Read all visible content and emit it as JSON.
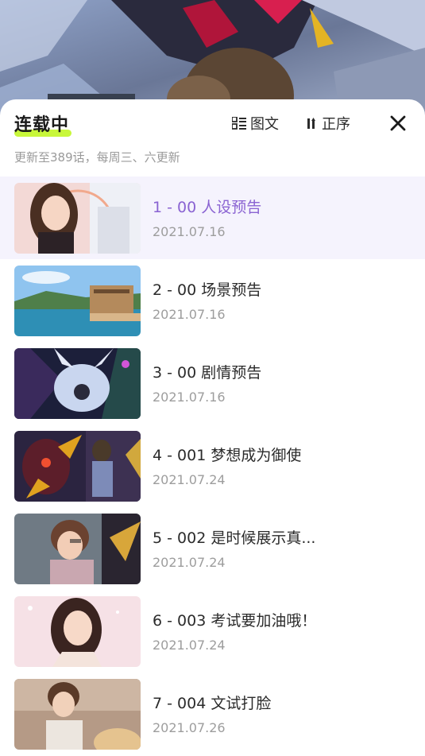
{
  "header": {
    "status_title": "连载中",
    "view_mode_label": "图文",
    "sort_label": "正序",
    "view_icon": "grid-list-icon",
    "sort_icon": "sort-order-icon",
    "close_icon": "close-icon"
  },
  "subtitle": "更新至389话，每周三、六更新",
  "colors": {
    "accent": "#8a63d2",
    "highlight": "#c8f73a",
    "active_row_bg": "#f5f3fd",
    "date_text": "#9d9d9d"
  },
  "chapters": [
    {
      "title": "1 - 00 人设预告",
      "date": "2021.07.16"
    },
    {
      "title": "2 - 00 场景预告",
      "date": "2021.07.16"
    },
    {
      "title": "3 - 00 剧情预告",
      "date": "2021.07.16"
    },
    {
      "title": "4 - 001 梦想成为御使",
      "date": "2021.07.24"
    },
    {
      "title": "5 - 002 是时候展示真...",
      "date": "2021.07.24"
    },
    {
      "title": "6 - 003 考试要加油哦！",
      "date": "2021.07.24"
    },
    {
      "title": "7 - 004 文试打脸",
      "date": "2021.07.26"
    }
  ]
}
